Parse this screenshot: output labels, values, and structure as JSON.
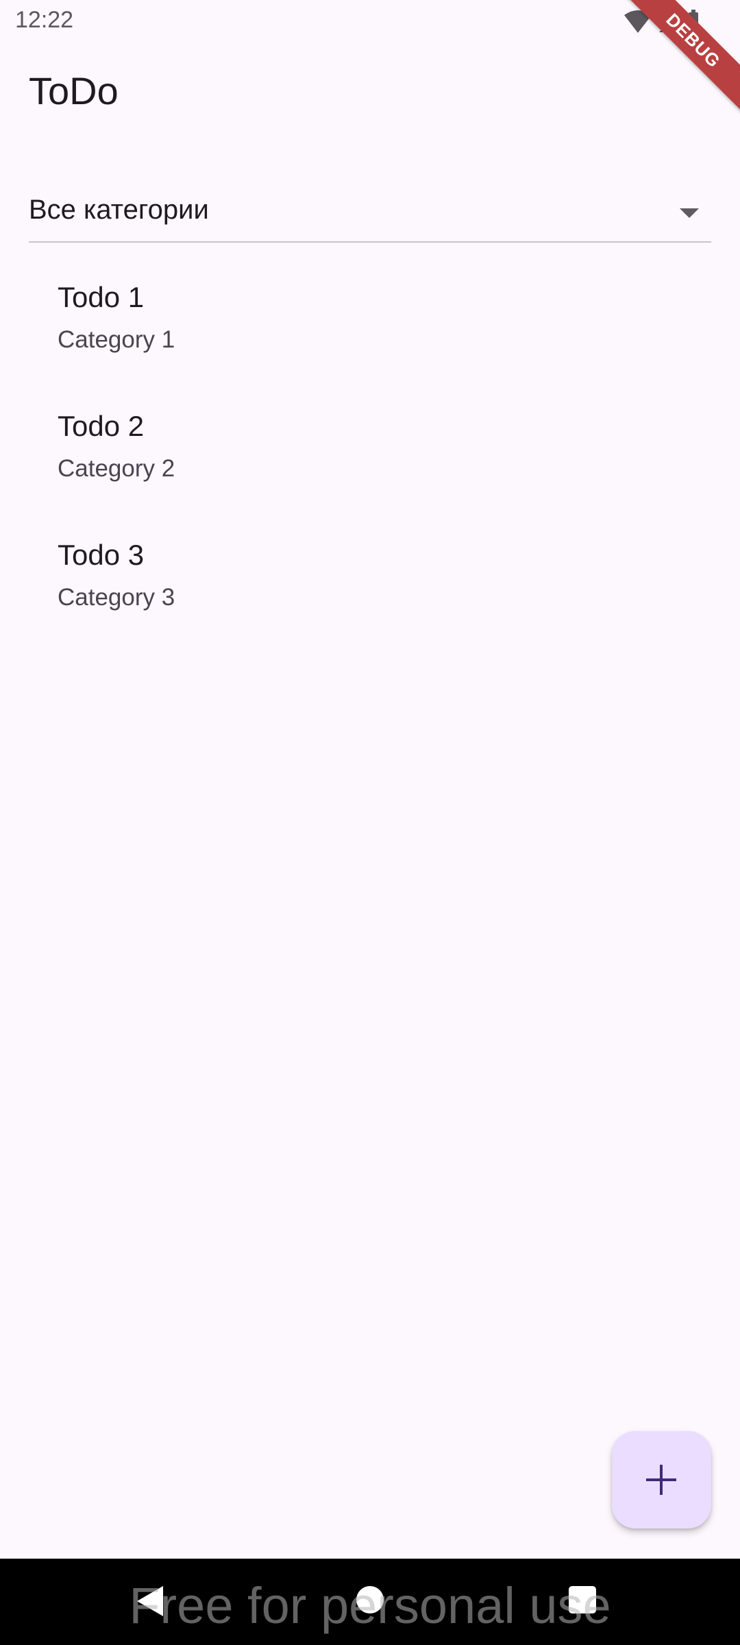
{
  "status_bar": {
    "time": "12:22",
    "icons": [
      "wifi-icon",
      "signal-icon",
      "battery-icon"
    ]
  },
  "debug_banner": "DEBUG",
  "app_bar": {
    "title": "ToDo"
  },
  "filter": {
    "selected": "Все категории",
    "icon": "dropdown-arrow-icon"
  },
  "todos": [
    {
      "title": "Todo 1",
      "category": "Category 1"
    },
    {
      "title": "Todo 2",
      "category": "Category 2"
    },
    {
      "title": "Todo 3",
      "category": "Category 3"
    }
  ],
  "fab": {
    "icon": "plus-icon",
    "color": "#eaddff"
  },
  "nav_bar": {
    "icons": [
      "back-icon",
      "home-icon",
      "recents-icon"
    ]
  },
  "watermark": "Free for personal use",
  "colors": {
    "background": "#fdf7fe",
    "accent": "#3f2a78",
    "debug": "#b94040"
  }
}
